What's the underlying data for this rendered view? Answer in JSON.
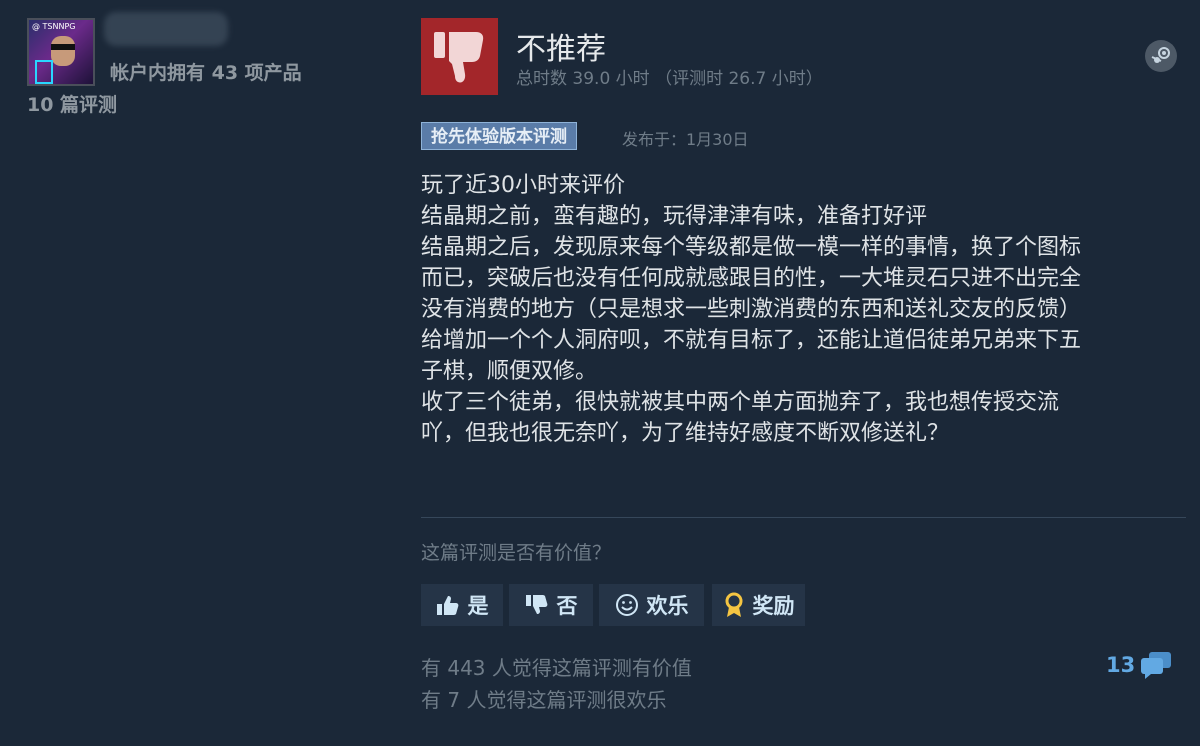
{
  "user": {
    "avatar_tag": "@ TSNNPG",
    "owned_products": "帐户内拥有 43 项产品",
    "reviews_count": "10 篇评测"
  },
  "review": {
    "verdict": "不推荐",
    "hours": "总时数 39.0 小时 （评测时 26.7 小时）",
    "badge": "抢先体验版本评测",
    "posted": "发布于：1月30日",
    "body": "玩了近30小时来评价\n结晶期之前，蛮有趣的，玩得津津有味，准备打好评\n结晶期之后，发现原来每个等级都是做一模一样的事情，换了个图标\n而已，突破后也没有任何成就感跟目的性，一大堆灵石只进不出完全\n没有消费的地方（只是想求一些刺激消费的东西和送礼交友的反馈）\n给增加一个个人洞府呗，不就有目标了，还能让道侣徒弟兄弟来下五\n子棋，顺便双修。\n收了三个徒弟，很快就被其中两个单方面抛弃了，我也想传授交流\n吖，但我也很无奈吖，为了维持好感度不断双修送礼？"
  },
  "feedback": {
    "question": "这篇评测是否有价值？",
    "yes_label": "是",
    "no_label": "否",
    "funny_label": "欢乐",
    "award_label": "奖励"
  },
  "stats": {
    "helpful": "有 443 人觉得这篇评测有价值",
    "funny": "有 7 人觉得这篇评测很欢乐",
    "comments": "13"
  },
  "colors": {
    "background": "#1b2838",
    "thumb_box": "#a3262a",
    "badge": "#5a7ca8",
    "button": "#253447",
    "comment_accent": "#62a9e3"
  }
}
